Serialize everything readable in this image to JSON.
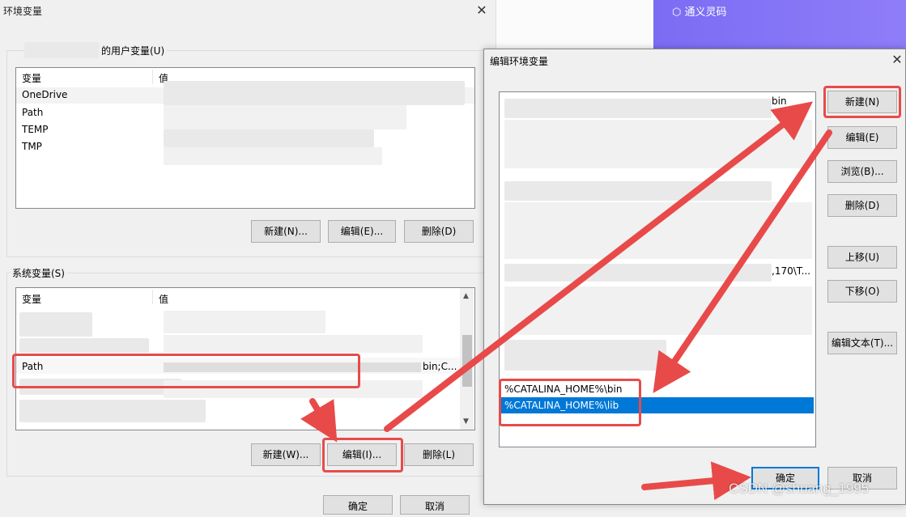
{
  "env_window": {
    "title": "环境变量",
    "close_glyph": "✕",
    "user_vars": {
      "group_label": "的用户变量(U)",
      "col_var": "变量",
      "col_val": "值",
      "rows": [
        "OneDrive",
        "Path",
        "TEMP",
        "TMP"
      ],
      "btn_new": "新建(N)...",
      "btn_edit": "编辑(E)...",
      "btn_delete": "删除(D)"
    },
    "sys_vars": {
      "group_label": "系统变量(S)",
      "col_var": "变量",
      "col_val": "值",
      "highlight_row_name": "Path",
      "highlight_row_value_tail": "bin;C...",
      "btn_new": "新建(W)...",
      "btn_edit": "编辑(I)...",
      "btn_delete": "删除(L)"
    },
    "btn_ok": "确定",
    "btn_cancel": "取消"
  },
  "background_app": {
    "brand": "通义灵码"
  },
  "edit_dialog": {
    "title": "编辑环境变量",
    "close_glyph": "✕",
    "list_fragments": {
      "top_right": "bin",
      "mid_right": ",170\\T..."
    },
    "entries": [
      "%CATALINA_HOME%\\bin",
      "%CATALINA_HOME%\\lib"
    ],
    "selected_index": 1,
    "buttons": {
      "new": "新建(N)",
      "edit": "编辑(E)",
      "browse": "浏览(B)...",
      "delete": "删除(D)",
      "move_up": "上移(U)",
      "move_down": "下移(O)",
      "edit_text": "编辑文本(T)..."
    },
    "btn_ok": "确定",
    "btn_cancel": "取消"
  },
  "watermark": "CSDN @shuang_1995",
  "colors": {
    "annotation_red": "#e84a4a",
    "selection_blue": "#0078d7",
    "brand_purple": "#7b6cf4"
  }
}
